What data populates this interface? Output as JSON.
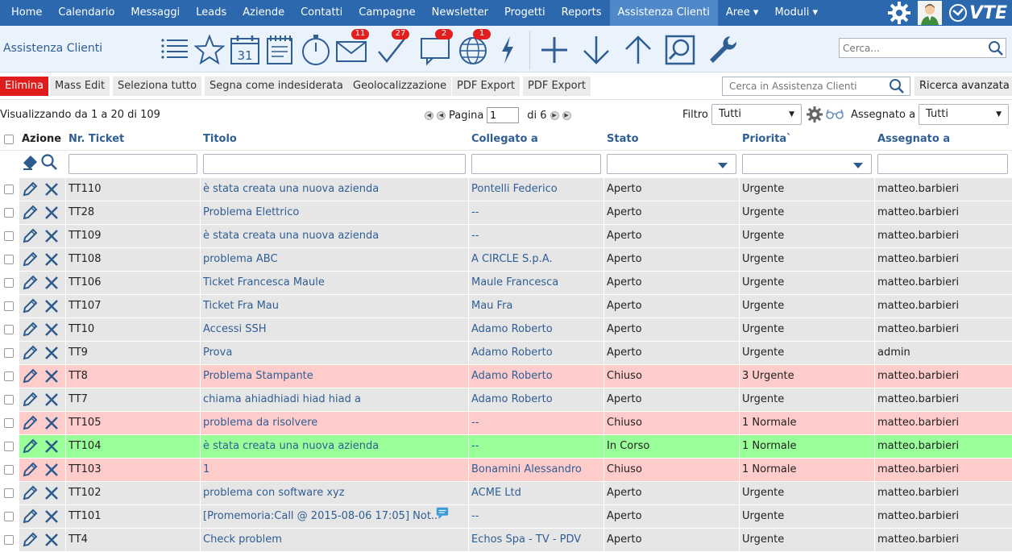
{
  "nav": {
    "items": [
      "Home",
      "Calendario",
      "Messaggi",
      "Leads",
      "Aziende",
      "Contatti",
      "Campagne",
      "Newsletter",
      "Progetti",
      "Reports",
      "Assistenza Clienti",
      "Aree ▾",
      "Moduli ▾"
    ],
    "active": "Assistenza Clienti",
    "logo": "VTE"
  },
  "toolbar": {
    "module_title": "Assistenza Clienti",
    "calendar_day": "31",
    "badges": {
      "messages": "11",
      "tasks": "27",
      "chat": "2",
      "web": "1"
    },
    "search_placeholder": "Cerca..."
  },
  "actions": {
    "elimina": "Elimina",
    "mass_edit": "Mass Edit",
    "select_all": "Seleziona tutto",
    "mark_spam": "Segna come indesiderata",
    "geo": "Geolocalizzazione",
    "pdf1": "PDF Export",
    "pdf2": "PDF Export",
    "module_search_placeholder": "Cerca in Assistenza Clienti",
    "advanced_search": "Ricerca avanzata"
  },
  "pager": {
    "showing": "Visualizzando da 1 a 20 di 109",
    "page_label": "Pagina",
    "page_value": "1",
    "of_label": "di 6",
    "filter_label": "Filtro",
    "filter_value": "Tutti",
    "assigned_label": "Assegnato a",
    "assigned_value": "Tutti"
  },
  "table": {
    "headers": {
      "azione": "Azione",
      "ticket": "Nr. Ticket",
      "titolo": "Titolo",
      "collegato": "Collegato a",
      "stato": "Stato",
      "priorita": "Priorita`",
      "assegnato": "Assegnato a"
    },
    "row_colors": {
      "default": "#e6e6e6",
      "closed": "#ffcccc",
      "progress": "#99ff99"
    },
    "rows": [
      {
        "ticket": "TT110",
        "titolo": "è stata creata una nuova azienda",
        "collegato": "Pontelli Federico",
        "stato": "Aperto",
        "priorita": "Urgente",
        "assegnato": "matteo.barbieri",
        "status": "default"
      },
      {
        "ticket": "TT28",
        "titolo": "Problema Elettrico",
        "collegato": "--",
        "stato": "Aperto",
        "priorita": "Urgente",
        "assegnato": "matteo.barbieri",
        "status": "default"
      },
      {
        "ticket": "TT109",
        "titolo": "è stata creata una nuova azienda",
        "collegato": "--",
        "stato": "Aperto",
        "priorita": "Urgente",
        "assegnato": "matteo.barbieri",
        "status": "default"
      },
      {
        "ticket": "TT108",
        "titolo": "problema ABC",
        "collegato": "A CIRCLE S.p.A.",
        "stato": "Aperto",
        "priorita": "Urgente",
        "assegnato": "matteo.barbieri",
        "status": "default"
      },
      {
        "ticket": "TT106",
        "titolo": "Ticket Francesca Maule",
        "collegato": "Maule Francesca",
        "stato": "Aperto",
        "priorita": "Urgente",
        "assegnato": "matteo.barbieri",
        "status": "default"
      },
      {
        "ticket": "TT107",
        "titolo": "Ticket Fra Mau",
        "collegato": "Mau Fra",
        "stato": "Aperto",
        "priorita": "Urgente",
        "assegnato": "matteo.barbieri",
        "status": "default"
      },
      {
        "ticket": "TT10",
        "titolo": "Accessi SSH",
        "collegato": "Adamo Roberto",
        "stato": "Aperto",
        "priorita": "Urgente",
        "assegnato": "matteo.barbieri",
        "status": "default"
      },
      {
        "ticket": "TT9",
        "titolo": "Prova",
        "collegato": "Adamo Roberto",
        "stato": "Aperto",
        "priorita": "Urgente",
        "assegnato": "admin",
        "status": "default"
      },
      {
        "ticket": "TT8",
        "titolo": "Problema Stampante",
        "collegato": "Adamo Roberto",
        "stato": "Chiuso",
        "priorita": "3 Urgente",
        "assegnato": "matteo.barbieri",
        "status": "closed"
      },
      {
        "ticket": "TT7",
        "titolo": "chiama ahiadhiadi hiad hiad a",
        "collegato": "Adamo Roberto",
        "stato": "Aperto",
        "priorita": "Urgente",
        "assegnato": "matteo.barbieri",
        "status": "default"
      },
      {
        "ticket": "TT105",
        "titolo": "problema da risolvere",
        "collegato": "--",
        "stato": "Chiuso",
        "priorita": "1 Normale",
        "assegnato": "matteo.barbieri",
        "status": "closed"
      },
      {
        "ticket": "TT104",
        "titolo": "è stata creata una nuova azienda",
        "collegato": "--",
        "stato": "In Corso",
        "priorita": "1 Normale",
        "assegnato": "matteo.barbieri",
        "status": "progress"
      },
      {
        "ticket": "TT103",
        "titolo": "1",
        "collegato": "Bonamini Alessandro",
        "stato": "Chiuso",
        "priorita": "1 Normale",
        "assegnato": "matteo.barbieri",
        "status": "closed"
      },
      {
        "ticket": "TT102",
        "titolo": "problema con software xyz",
        "collegato": "ACME Ltd",
        "stato": "Aperto",
        "priorita": "Urgente",
        "assegnato": "matteo.barbieri",
        "status": "default"
      },
      {
        "ticket": "TT101",
        "titolo": "[Promemoria:Call @ 2015-08-06 17:05] Not...",
        "collegato": "--",
        "stato": "Aperto",
        "priorita": "Urgente",
        "assegnato": "matteo.barbieri",
        "status": "default",
        "comment": true
      },
      {
        "ticket": "TT4",
        "titolo": "Check problem",
        "collegato": "Echos Spa - TV - PDV",
        "stato": "Aperto",
        "priorita": "Urgente",
        "assegnato": "matteo.barbieri",
        "status": "default"
      }
    ]
  }
}
